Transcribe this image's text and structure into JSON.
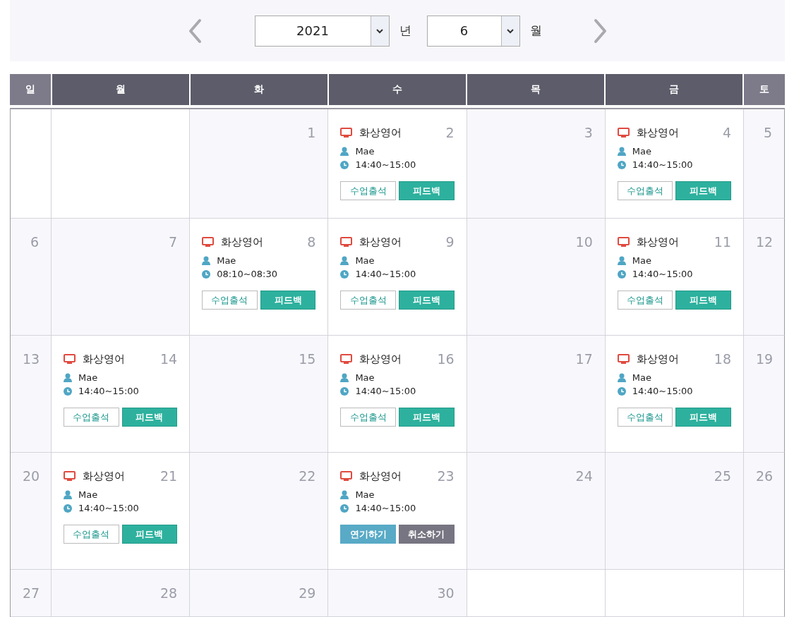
{
  "navigation": {
    "year": {
      "value": "2021",
      "label": "년"
    },
    "month": {
      "value": "6",
      "label": "월"
    }
  },
  "weekdays": [
    {
      "label": "일",
      "kind": "weekend"
    },
    {
      "label": "월",
      "kind": "weekday"
    },
    {
      "label": "화",
      "kind": "weekday"
    },
    {
      "label": "수",
      "kind": "weekday"
    },
    {
      "label": "목",
      "kind": "weekday"
    },
    {
      "label": "금",
      "kind": "weekday"
    },
    {
      "label": "토",
      "kind": "weekend"
    }
  ],
  "weeks": [
    [
      {
        "kind": "blank"
      },
      {
        "kind": "blank"
      },
      {
        "kind": "day",
        "date": "1"
      },
      {
        "kind": "event",
        "date": "2",
        "event": {
          "title": "화상영어",
          "teacher": "Mae",
          "time": "14:40~15:00",
          "buttons": [
            {
              "label": "수업출석",
              "kind": "outline"
            },
            {
              "label": "피드백",
              "kind": "teal"
            }
          ]
        }
      },
      {
        "kind": "day",
        "date": "3"
      },
      {
        "kind": "event",
        "date": "4",
        "event": {
          "title": "화상영어",
          "teacher": "Mae",
          "time": "14:40~15:00",
          "buttons": [
            {
              "label": "수업출석",
              "kind": "outline"
            },
            {
              "label": "피드백",
              "kind": "teal"
            }
          ]
        }
      },
      {
        "kind": "day",
        "date": "5"
      }
    ],
    [
      {
        "kind": "day",
        "date": "6"
      },
      {
        "kind": "day",
        "date": "7"
      },
      {
        "kind": "event",
        "date": "8",
        "event": {
          "title": "화상영어",
          "teacher": "Mae",
          "time": "08:10~08:30",
          "buttons": [
            {
              "label": "수업출석",
              "kind": "outline"
            },
            {
              "label": "피드백",
              "kind": "teal"
            }
          ]
        }
      },
      {
        "kind": "event",
        "date": "9",
        "event": {
          "title": "화상영어",
          "teacher": "Mae",
          "time": "14:40~15:00",
          "buttons": [
            {
              "label": "수업출석",
              "kind": "outline"
            },
            {
              "label": "피드백",
              "kind": "teal"
            }
          ]
        }
      },
      {
        "kind": "day",
        "date": "10"
      },
      {
        "kind": "event",
        "date": "11",
        "event": {
          "title": "화상영어",
          "teacher": "Mae",
          "time": "14:40~15:00",
          "buttons": [
            {
              "label": "수업출석",
              "kind": "outline"
            },
            {
              "label": "피드백",
              "kind": "teal"
            }
          ]
        }
      },
      {
        "kind": "day",
        "date": "12"
      }
    ],
    [
      {
        "kind": "day",
        "date": "13"
      },
      {
        "kind": "event",
        "date": "14",
        "event": {
          "title": "화상영어",
          "teacher": "Mae",
          "time": "14:40~15:00",
          "buttons": [
            {
              "label": "수업출석",
              "kind": "outline"
            },
            {
              "label": "피드백",
              "kind": "teal"
            }
          ]
        }
      },
      {
        "kind": "day",
        "date": "15"
      },
      {
        "kind": "event",
        "date": "16",
        "event": {
          "title": "화상영어",
          "teacher": "Mae",
          "time": "14:40~15:00",
          "buttons": [
            {
              "label": "수업출석",
              "kind": "outline"
            },
            {
              "label": "피드백",
              "kind": "teal"
            }
          ]
        }
      },
      {
        "kind": "day",
        "date": "17"
      },
      {
        "kind": "event",
        "date": "18",
        "event": {
          "title": "화상영어",
          "teacher": "Mae",
          "time": "14:40~15:00",
          "buttons": [
            {
              "label": "수업출석",
              "kind": "outline"
            },
            {
              "label": "피드백",
              "kind": "teal"
            }
          ]
        }
      },
      {
        "kind": "day",
        "date": "19"
      }
    ],
    [
      {
        "kind": "day",
        "date": "20"
      },
      {
        "kind": "event",
        "date": "21",
        "event": {
          "title": "화상영어",
          "teacher": "Mae",
          "time": "14:40~15:00",
          "buttons": [
            {
              "label": "수업출석",
              "kind": "outline"
            },
            {
              "label": "피드백",
              "kind": "teal"
            }
          ]
        }
      },
      {
        "kind": "day",
        "date": "22"
      },
      {
        "kind": "event",
        "date": "23",
        "event": {
          "title": "화상영어",
          "teacher": "Mae",
          "time": "14:40~15:00",
          "buttons": [
            {
              "label": "연기하기",
              "kind": "blue"
            },
            {
              "label": "취소하기",
              "kind": "gray"
            }
          ]
        }
      },
      {
        "kind": "day",
        "date": "24"
      },
      {
        "kind": "day",
        "date": "25"
      },
      {
        "kind": "day",
        "date": "26"
      }
    ],
    [
      {
        "kind": "day",
        "date": "27"
      },
      {
        "kind": "day",
        "date": "28"
      },
      {
        "kind": "day",
        "date": "29"
      },
      {
        "kind": "day",
        "date": "30"
      },
      {
        "kind": "blank"
      },
      {
        "kind": "blank"
      },
      {
        "kind": "blank"
      }
    ]
  ]
}
